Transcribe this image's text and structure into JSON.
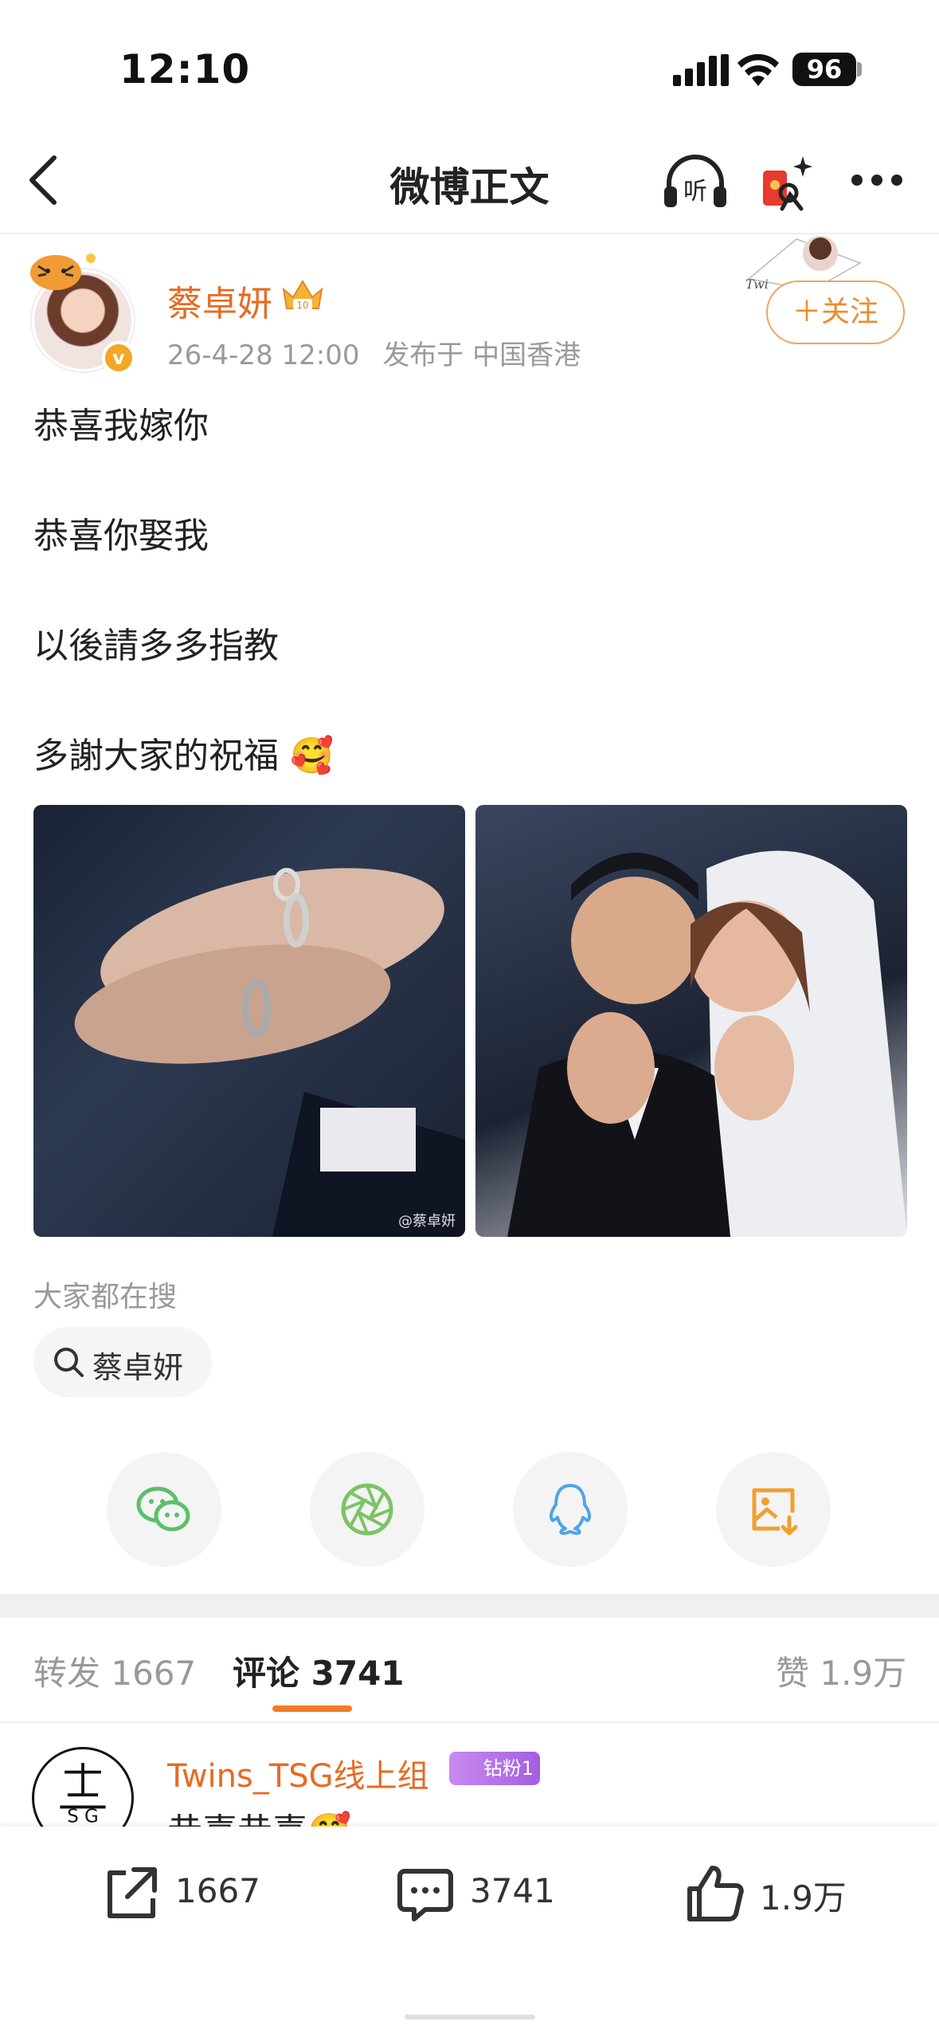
{
  "status_bar": {
    "time": "12:10",
    "battery": "96"
  },
  "nav": {
    "title": "微博正文",
    "listen_label": "听"
  },
  "author": {
    "name": "蔡卓妍",
    "date": "26-4-28 12:00",
    "location": "发布于 中国香港",
    "follow_label": "＋关注",
    "verified_mark": "v"
  },
  "post": {
    "lines": [
      "恭喜我嫁你",
      "恭喜你娶我",
      "以後請多多指教",
      "多謝大家的祝福 🥰"
    ],
    "watermark": "@蔡卓妍"
  },
  "search": {
    "label": "大家都在搜",
    "chip": "蔡卓妍"
  },
  "tabs": {
    "repost": "转发 1667",
    "comment": "评论 3741",
    "like": "赞 1.9万"
  },
  "comment": {
    "user": "Twins_TSG线上组",
    "badge": "钻粉1",
    "text": "恭喜恭喜🥰"
  },
  "bottom_bar": {
    "repost": "1667",
    "comment": "3741",
    "like": "1.9万"
  },
  "colors": {
    "accent": "#f07c2a",
    "name": "#e86a20",
    "follow_border": "#f2a35a"
  }
}
